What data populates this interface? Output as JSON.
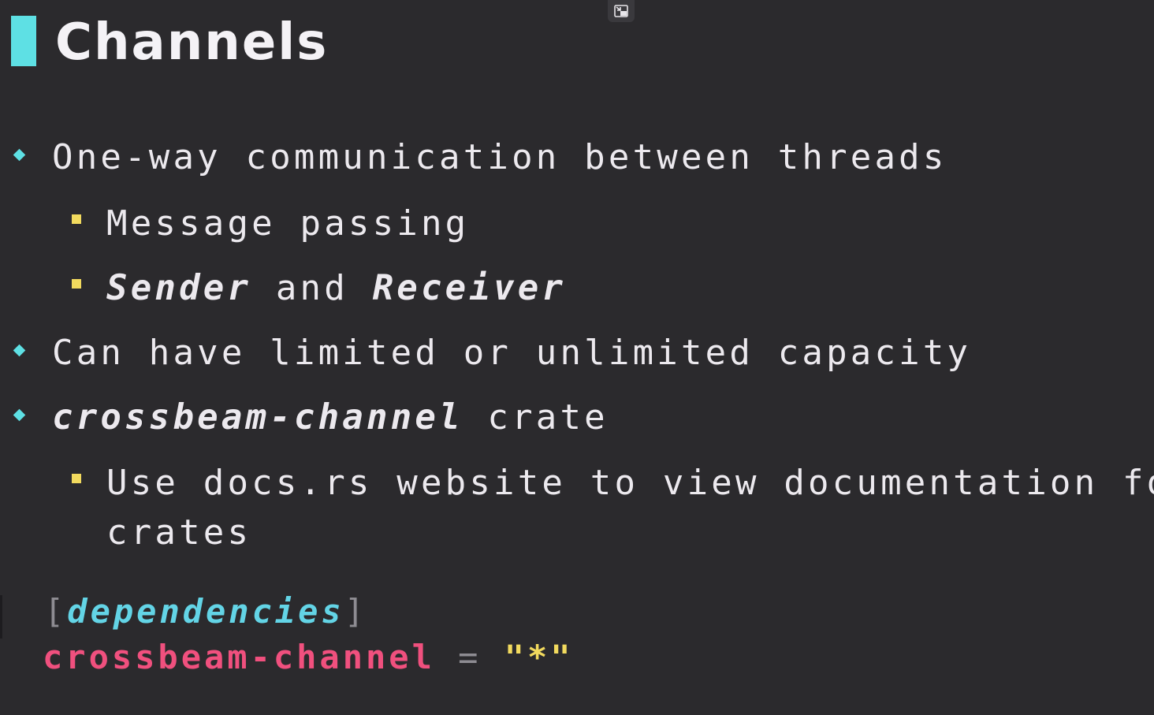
{
  "slide": {
    "title": "Channels",
    "bullets": [
      {
        "text": "One-way communication between threads"
      },
      {
        "text": "Message passing"
      },
      {
        "sender": "Sender",
        "and": " and ",
        "receiver": "Receiver"
      },
      {
        "text": "Can have limited or unlimited capacity"
      },
      {
        "crate_name": "crossbeam-channel",
        "rest": " crate"
      },
      {
        "line1": "Use docs.rs website to view documentation for",
        "line2": "crates"
      }
    ],
    "code": {
      "open_bracket": "[",
      "section": "dependencies",
      "close_bracket": "]",
      "key": "crossbeam-channel",
      "equals": " = ",
      "value": "\"*\""
    }
  },
  "colors": {
    "background": "#2b2a2d",
    "accent_cyan": "#5ee0e4",
    "accent_yellow": "#f2da5e",
    "code_key_pink": "#f0507e"
  },
  "icons": {
    "exit_fullscreen": "exit-fullscreen-icon"
  }
}
